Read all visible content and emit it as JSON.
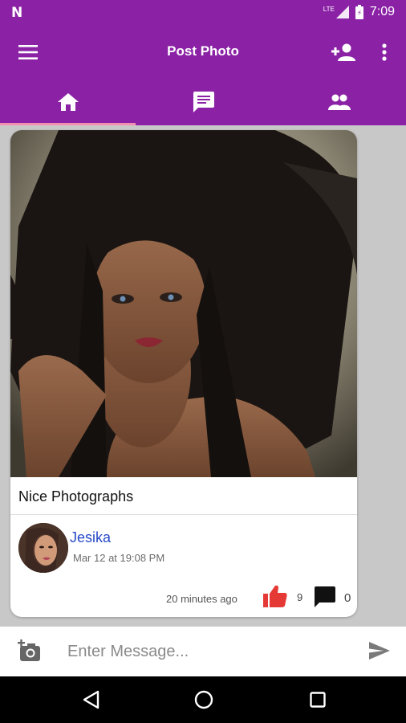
{
  "status_bar": {
    "network": "LTE",
    "time": "7:09",
    "colors": {
      "bar": "#8b22a6"
    }
  },
  "app_bar": {
    "title": "Post Photo",
    "icons": [
      "menu-icon",
      "add-person-icon",
      "more-vert-icon"
    ]
  },
  "tabs": [
    {
      "name": "home",
      "icon": "home-icon",
      "selected": true
    },
    {
      "name": "messages",
      "icon": "chat-icon",
      "selected": false
    },
    {
      "name": "people",
      "icon": "people-icon",
      "selected": false
    }
  ],
  "post": {
    "caption": "Nice Photographs",
    "author": "Jesika",
    "date": "Mar 12 at 19:08 PM",
    "time_ago": "20 minutes ago",
    "likes": "9",
    "comments": "0"
  },
  "composer": {
    "placeholder": "Enter Message...",
    "icons": [
      "add-photo-icon",
      "send-icon"
    ]
  },
  "colors": {
    "primary": "#8b22a6",
    "tab_indicator": "#f48fb1",
    "author": "#2648c8",
    "like": "#e53935"
  }
}
